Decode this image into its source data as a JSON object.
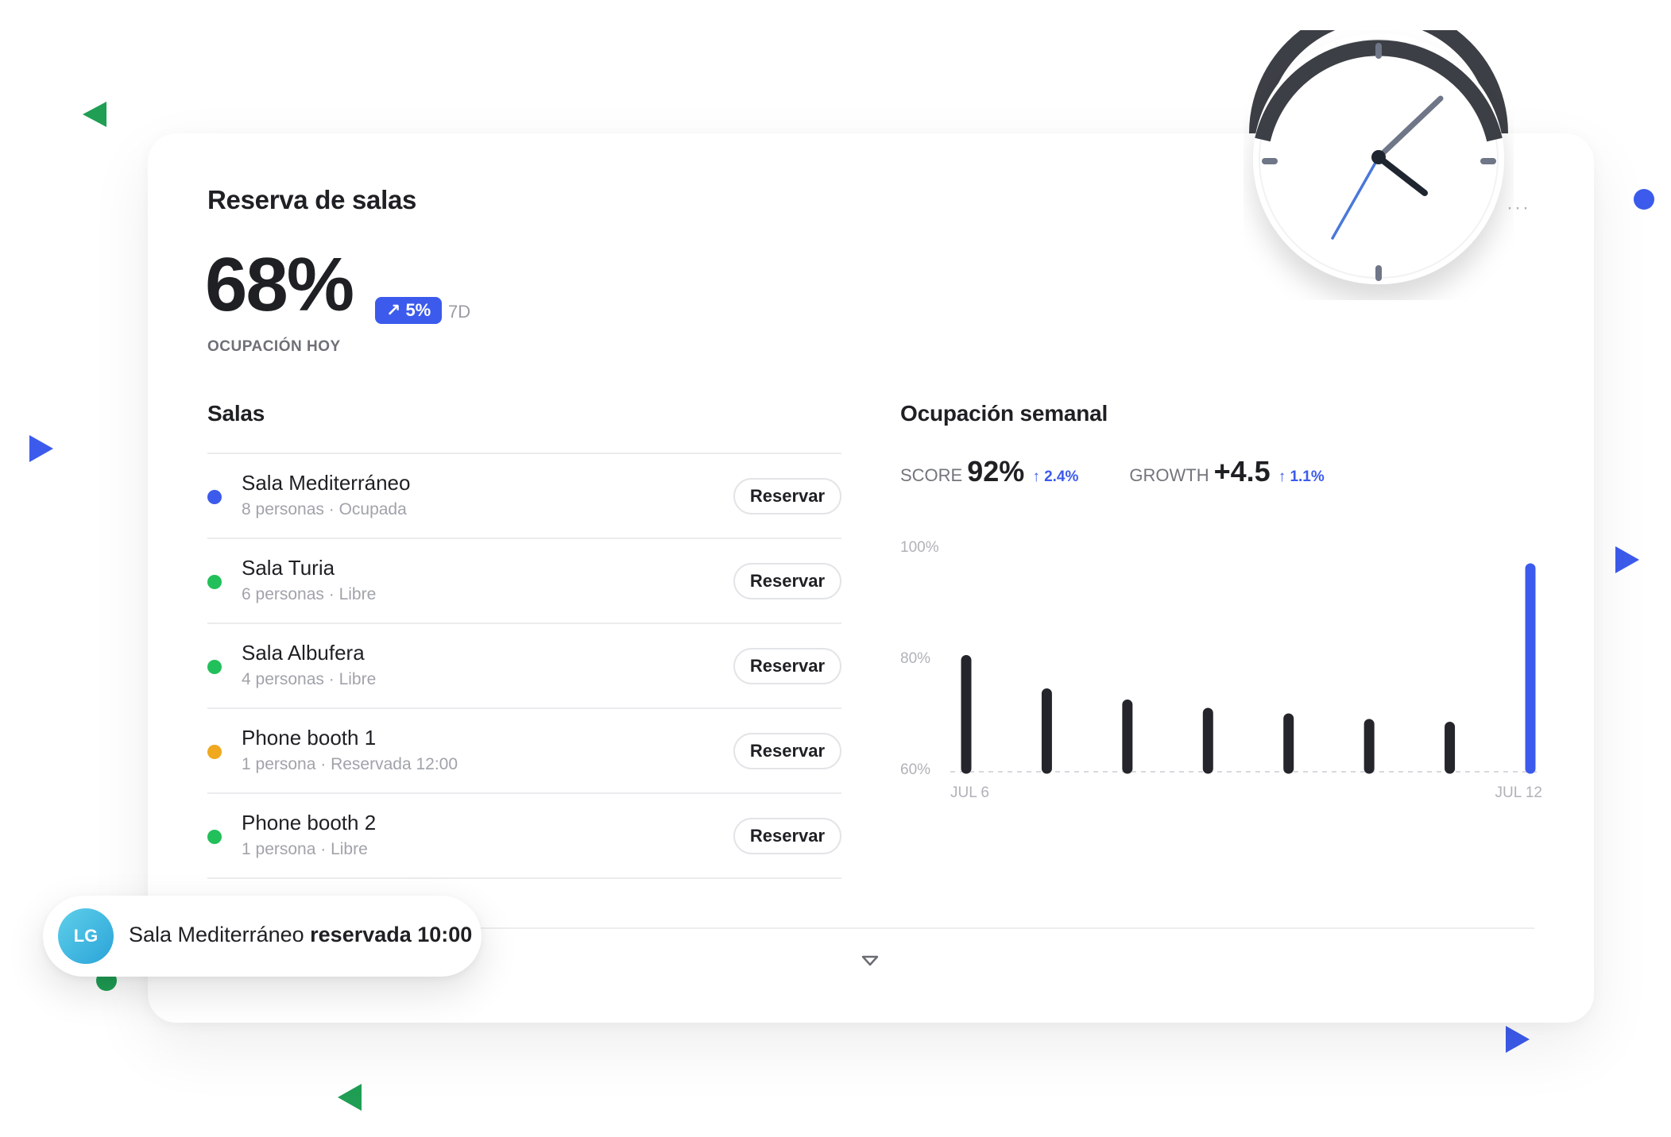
{
  "card": {
    "title": "Reserva de salas",
    "occupancy_value": "68%",
    "badge_delta": "5%",
    "badge_period": "7D",
    "occupancy_label": "OCUPACIÓN HOY",
    "more_icon": "ellipsis-icon"
  },
  "rooms": {
    "title": "Salas",
    "button_label": "Reservar",
    "items": [
      {
        "name": "Sala Mediterráneo",
        "details": "8 personas · Ocupada",
        "status_color": "#3c5bec"
      },
      {
        "name": "Sala Turia",
        "details": "6 personas · Libre",
        "status_color": "#22c05a"
      },
      {
        "name": "Sala Albufera",
        "details": "4 personas · Libre",
        "status_color": "#22c05a"
      },
      {
        "name": "Phone booth 1",
        "details": "1 persona · Reservada 12:00",
        "status_color": "#f0a820"
      },
      {
        "name": "Phone booth 2",
        "details": "1 persona · Libre",
        "status_color": "#22c05a"
      }
    ]
  },
  "weekly": {
    "title": "Ocupación semanal",
    "score_label": "SCORE",
    "score_value": "92%",
    "score_delta": "↑ 2.4%",
    "growth_label": "GROWTH",
    "growth_value": "+4.5",
    "growth_delta": "↑ 1.1%"
  },
  "chart_data": {
    "type": "bar",
    "title": "Ocupación semanal",
    "y_ticks": [
      "100%",
      "80%",
      "60%"
    ],
    "ylim": [
      60,
      100
    ],
    "x_tick_labels": [
      "JUL 6",
      "JUL 12"
    ],
    "values": [
      79.5,
      73.5,
      71.5,
      70,
      69,
      68,
      67.5,
      96
    ],
    "bar_color": "#25262b",
    "highlight_color": "#3c5bec",
    "highlight_index": 7,
    "grid": false
  },
  "toast": {
    "avatar_initials": "LG",
    "message": "Sala Mediterráneo",
    "message_bold": "reservada 10:00"
  },
  "colors": {
    "accent": "#3c5bec",
    "green": "#22c05a",
    "amber": "#f0a820",
    "decor_green": "#1f9e54"
  }
}
